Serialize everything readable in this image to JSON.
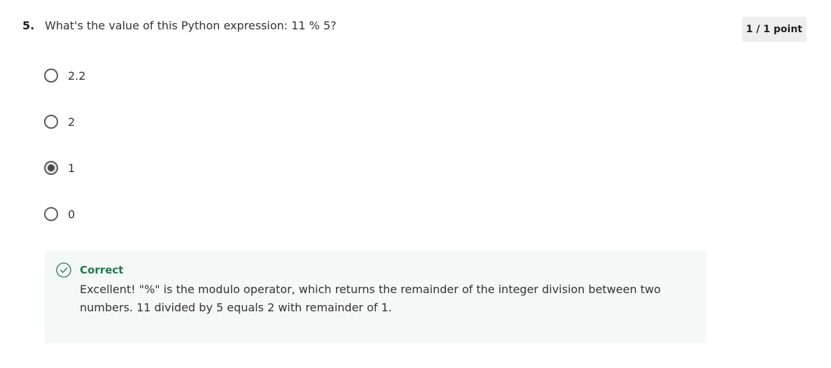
{
  "question": {
    "number": "5.",
    "text": "What's the value of this Python expression: 11 % 5?",
    "points": "1 / 1 point"
  },
  "options": [
    {
      "label": "2.2",
      "selected": false
    },
    {
      "label": "2",
      "selected": false
    },
    {
      "label": "1",
      "selected": true
    },
    {
      "label": "0",
      "selected": false
    }
  ],
  "feedback": {
    "status": "Correct",
    "message": "Excellent! \"%\" is the modulo operator, which returns the remainder of the integer division between two numbers. 11 divided by 5 equals 2 with remainder of 1.",
    "icon": "check-circle-icon"
  },
  "colors": {
    "correct": "#1f7a4d",
    "feedback_bg": "#f4f8f6",
    "badge_bg": "#eeeeee"
  }
}
